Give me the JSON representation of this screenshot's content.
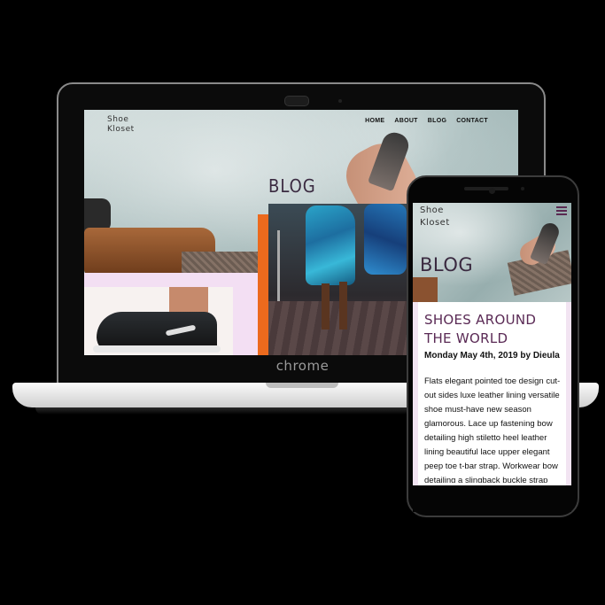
{
  "site": {
    "logo_line1": "Shoe",
    "logo_line2": "Kloset"
  },
  "nav": {
    "items": [
      {
        "label": "HOME"
      },
      {
        "label": "ABOUT"
      },
      {
        "label": "BLOG"
      },
      {
        "label": "CONTACT"
      }
    ]
  },
  "laptop": {
    "brand": "chrome",
    "hero_title": "BLOG"
  },
  "phone": {
    "hero_title": "BLOG",
    "post": {
      "title": "SHOES AROUND THE WORLD",
      "date": "Monday May 4th, 2019 by Dieula",
      "body": "Flats elegant pointed toe design cut-out sides luxe leather lining versatile shoe must-have new season glamorous. Lace up fastening bow detailing high stiletto heel leather lining beautiful lace upper elegant peep toe t-bar strap. Workwear bow detailing a slingback buckle strap"
    }
  },
  "colors": {
    "accent_orange": "#ec6a1d",
    "accent_pink": "#f3dff3",
    "title_purple": "#5a2a55"
  },
  "icons": {
    "menu": "hamburger-menu-icon"
  }
}
